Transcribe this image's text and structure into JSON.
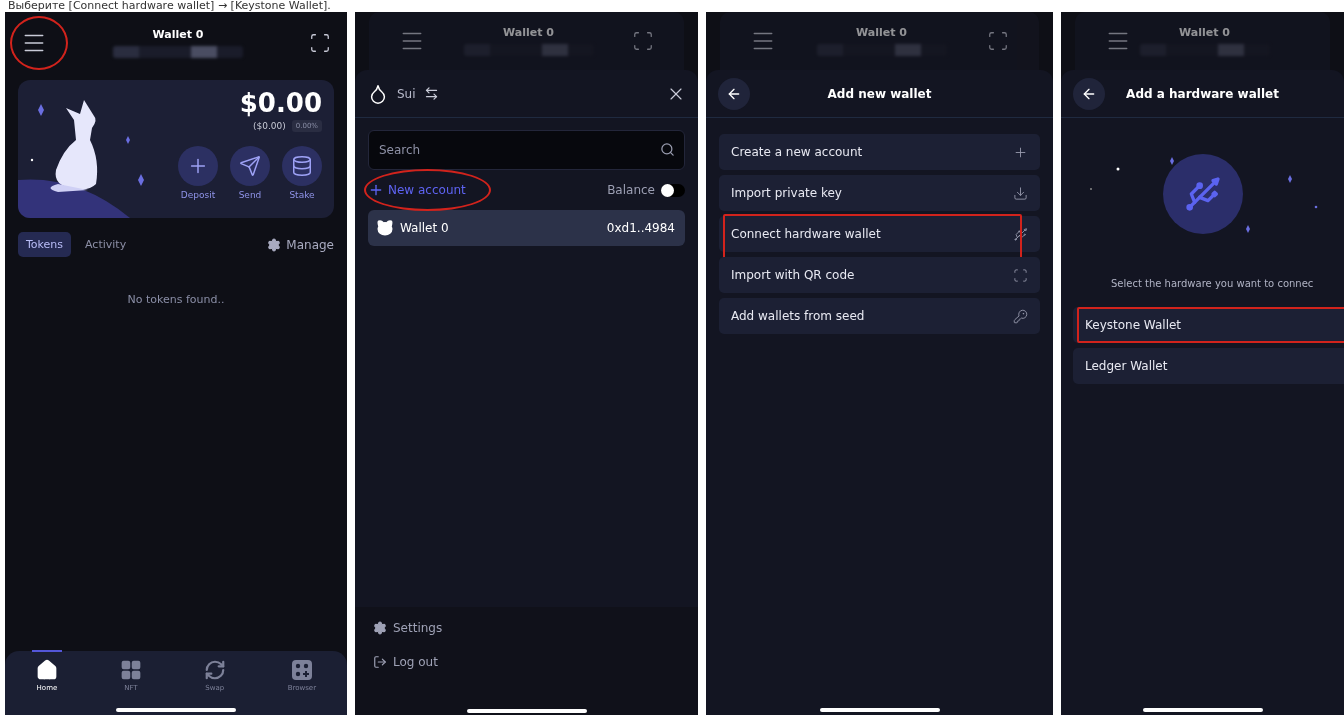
{
  "caption": "Выберите [Connect hardware wallet] → [Keystone Wallet].",
  "screens": [
    {
      "kind": "home",
      "header": {
        "title": "Wallet 0",
        "covered": false,
        "scan_visible": true,
        "menu_highlighted": true
      },
      "balance": {
        "amount": "$0.00",
        "fiat": "($0.00)",
        "change": "0.00%"
      },
      "actions": [
        {
          "label": "Deposit"
        },
        {
          "label": "Send"
        },
        {
          "label": "Stake"
        }
      ],
      "tabs": [
        {
          "label": "Tokens",
          "selected": true
        },
        {
          "label": "Activity",
          "selected": false
        }
      ],
      "manage": "Manage",
      "empty": "No tokens found..",
      "nav": [
        {
          "label": "Home",
          "selected": true
        },
        {
          "label": "NFT",
          "selected": false
        },
        {
          "label": "Swap",
          "selected": false
        },
        {
          "label": "Browser",
          "selected": false
        }
      ]
    },
    {
      "kind": "accounts",
      "header": {
        "title": "Wallet 0",
        "covered": true,
        "scan_visible": true,
        "menu_highlighted": false
      },
      "network": "Sui",
      "search": {
        "placeholder": "Search"
      },
      "new_account": {
        "label": "New account",
        "highlighted": true
      },
      "balance_toggle": {
        "label": "Balance",
        "on": false
      },
      "accounts": [
        {
          "name": "Wallet 0",
          "address": "0xd1..4984",
          "selected": true
        }
      ],
      "footer": [
        {
          "label": "Settings"
        },
        {
          "label": "Log out"
        }
      ]
    },
    {
      "kind": "add_wallet",
      "header": {
        "title": "Wallet 0",
        "covered": true,
        "scan_visible": true,
        "menu_highlighted": false
      },
      "title": "Add new wallet",
      "options": [
        {
          "label": "Create a new account",
          "highlighted": false
        },
        {
          "label": "Import private key",
          "highlighted": false
        },
        {
          "label": "Connect hardware wallet",
          "highlighted": true
        },
        {
          "label": "Import with QR code",
          "highlighted": false
        },
        {
          "label": "Add wallets from seed",
          "highlighted": false
        }
      ]
    },
    {
      "kind": "hardware",
      "header": {
        "title": "Wallet 0",
        "covered": true,
        "scan_visible": false,
        "menu_highlighted": false
      },
      "title": "Add a hardware wallet",
      "prompt": "Select the hardware you want to connec",
      "options": [
        {
          "label": "Keystone Wallet",
          "highlighted": true
        },
        {
          "label": "Ledger Wallet",
          "highlighted": false
        }
      ]
    }
  ]
}
